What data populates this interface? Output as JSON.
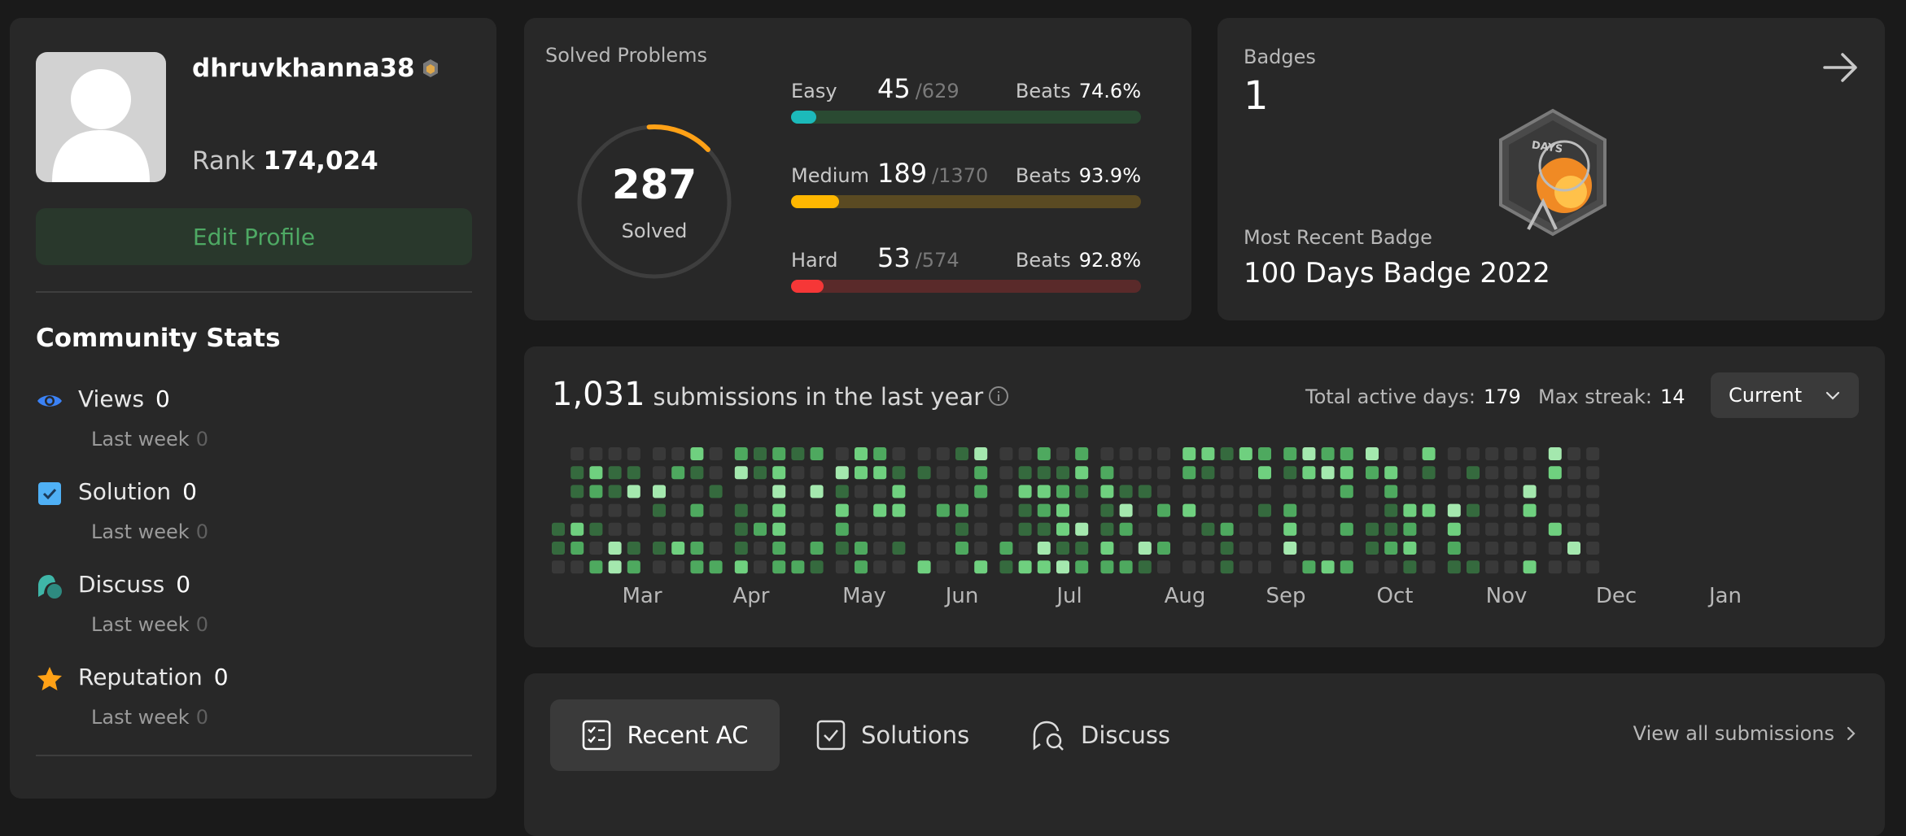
{
  "profile": {
    "username": "dhruvkhanna38",
    "rank_label": "Rank",
    "rank_value": "174,024",
    "edit_profile_label": "Edit Profile"
  },
  "community_stats": {
    "title": "Community Stats",
    "items": [
      {
        "label": "Views",
        "value": "0",
        "last_week_label": "Last week",
        "last_week_value": "0",
        "icon": "eye-icon",
        "color": "#3b82f6"
      },
      {
        "label": "Solution",
        "value": "0",
        "last_week_label": "Last week",
        "last_week_value": "0",
        "icon": "checkbox-icon",
        "color": "#4fb0f5"
      },
      {
        "label": "Discuss",
        "value": "0",
        "last_week_label": "Last week",
        "last_week_value": "0",
        "icon": "discuss-icon",
        "color": "#3fb6a8"
      },
      {
        "label": "Reputation",
        "value": "0",
        "last_week_label": "Last week",
        "last_week_value": "0",
        "icon": "star-icon",
        "color": "#ffa116"
      }
    ]
  },
  "solved": {
    "title": "Solved Problems",
    "total": "287",
    "total_label": "Solved",
    "difficulties": [
      {
        "name": "Easy",
        "count": "45",
        "total": "/629",
        "beats_label": "Beats",
        "beats": "74.6%",
        "fraction": 0.072,
        "color": "#1cbaba",
        "track": "#2a4a32"
      },
      {
        "name": "Medium",
        "count": "189",
        "total": "/1370",
        "beats_label": "Beats",
        "beats": "93.9%",
        "fraction": 0.138,
        "color": "#ffb700",
        "track": "#5a4a22"
      },
      {
        "name": "Hard",
        "count": "53",
        "total": "/574",
        "beats_label": "Beats",
        "beats": "92.8%",
        "fraction": 0.092,
        "color": "#f63737",
        "track": "#5a2a2a"
      }
    ]
  },
  "badges": {
    "title": "Badges",
    "count": "1",
    "badge_text": "DAYS",
    "recent_label": "Most Recent Badge",
    "recent_name": "100 Days Badge 2022"
  },
  "submissions": {
    "count": "1,031",
    "label": "submissions in the last year",
    "active_days_label": "Total active days:",
    "active_days": "179",
    "max_streak_label": "Max streak:",
    "max_streak": "14",
    "year_select": "Current",
    "months": [
      "Mar",
      "Apr",
      "May",
      "Jun",
      "Jul",
      "Aug",
      "Sep",
      "Oct",
      "Nov",
      "Dec",
      "Jan"
    ],
    "colors": {
      "empty": "#393939",
      "l1": "#356a3e",
      "l2": "#4ea95f",
      "l3": "#6fd07f",
      "l4": "#a4e8ae"
    }
  },
  "tabs": {
    "items": [
      {
        "label": "Recent AC",
        "icon": "list-check-icon"
      },
      {
        "label": "Solutions",
        "icon": "checkbox-icon"
      },
      {
        "label": "Discuss",
        "icon": "discuss-icon"
      }
    ],
    "view_all": "View all submissions"
  }
}
